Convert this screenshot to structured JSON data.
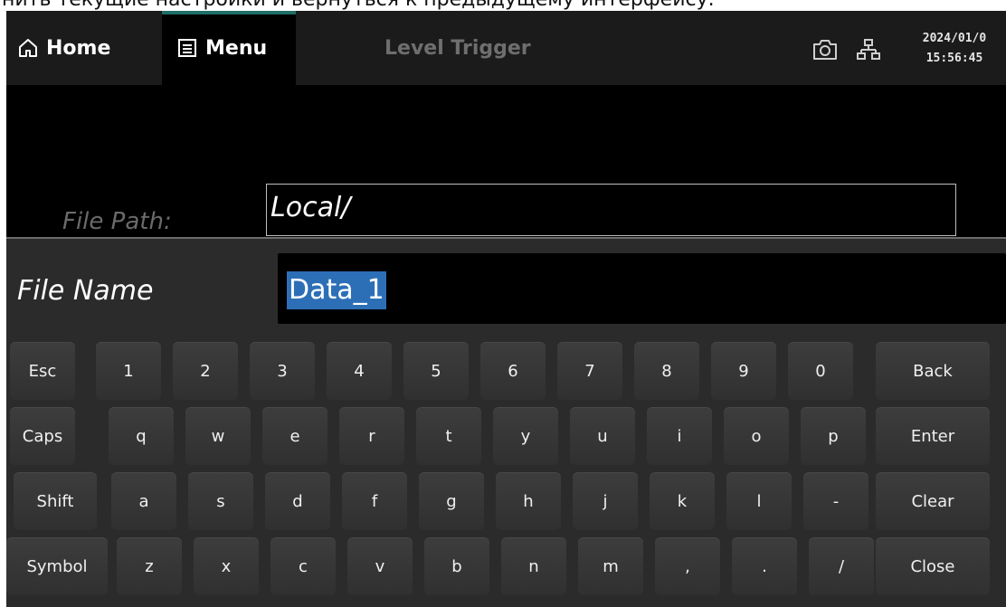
{
  "caption": "нить текущие настройки и вернуться к предыдущему интерфейсу.",
  "topbar": {
    "home_label": "Home",
    "menu_label": "Menu",
    "title": "Level Trigger",
    "date": "2024/01/0",
    "time": "15:56:45"
  },
  "file_path": {
    "label": "File Path:",
    "value": "Local/"
  },
  "file_name": {
    "label": "File Name",
    "value": "Data_1"
  },
  "keyboard": {
    "rows": [
      [
        "Esc",
        "1",
        "2",
        "3",
        "4",
        "5",
        "6",
        "7",
        "8",
        "9",
        "0",
        "Back"
      ],
      [
        "Caps",
        "q",
        "w",
        "e",
        "r",
        "t",
        "y",
        "u",
        "i",
        "o",
        "p",
        "Enter"
      ],
      [
        "Shift",
        "a",
        "s",
        "d",
        "f",
        "g",
        "h",
        "j",
        "k",
        "l",
        "-",
        "Clear"
      ],
      [
        "Symbol",
        "z",
        "x",
        "c",
        "v",
        "b",
        "n",
        "m",
        ",",
        ".",
        "/",
        "Close"
      ]
    ]
  },
  "colors": {
    "accent_tab": "#1e6f66",
    "selection": "#2d6fb7",
    "key_bg": "#353535"
  },
  "icons": [
    "home-icon",
    "menu-icon",
    "camera-icon",
    "network-icon"
  ]
}
